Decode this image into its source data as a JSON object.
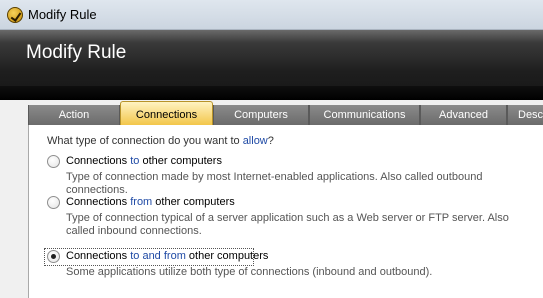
{
  "window": {
    "title": "Modify Rule"
  },
  "header": {
    "title": "Modify Rule"
  },
  "tabs": [
    "Action",
    "Connections",
    "Computers",
    "Communications",
    "Advanced",
    "Desc"
  ],
  "active_tab": "Connections",
  "question": {
    "text": "What type of connection do you want to ",
    "emphasis": "allow",
    "end": "?"
  },
  "options": [
    {
      "pre": "Connections ",
      "em": "to",
      "post": " other computers",
      "desc": "Type of connection made by most Internet-enabled applications. Also called outbound connections.",
      "selected": false
    },
    {
      "pre": "Connections ",
      "em": "from",
      "post": " other computers",
      "desc": "Type of connection typical of a server application such as a Web server or FTP server. Also called inbound connections.",
      "selected": false
    },
    {
      "pre": "Connections ",
      "em": "to and from",
      "post": " other computers",
      "desc": "Some applications utilize both type of connections (inbound and outbound).",
      "selected": true
    }
  ],
  "colors": {
    "accent": "#1f4aa5",
    "tab_active": "#f2c445",
    "header": "#1e1e1e"
  }
}
